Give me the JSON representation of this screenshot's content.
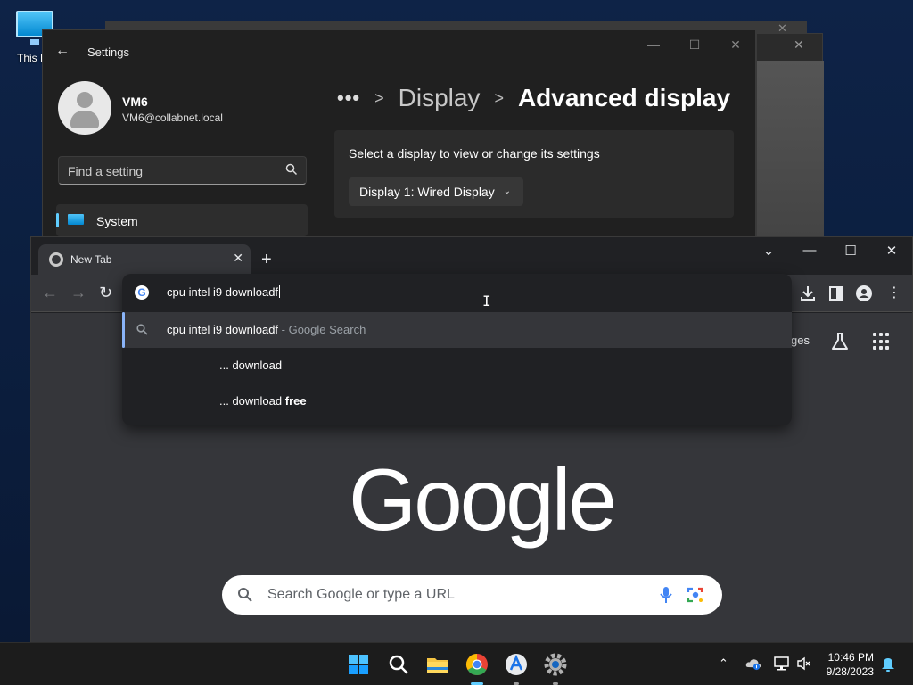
{
  "desktop": {
    "icon_label": "This P"
  },
  "settings": {
    "title": "Settings",
    "user_name": "VM6",
    "user_email": "VM6@collabnet.local",
    "search_placeholder": "Find a setting",
    "nav_item": "System",
    "breadcrumb": {
      "more": "•••",
      "parent": "Display",
      "current": "Advanced display"
    },
    "card_prompt": "Select a display to view or change its settings",
    "display_select": "Display 1: Wired Display"
  },
  "chrome": {
    "tab_title": "New Tab",
    "omnibox_text": "cpu intel i9 downloadf",
    "suggestions": [
      {
        "text": "cpu intel i9 downloadf",
        "suffix": " - Google Search"
      },
      {
        "prefix": "... ",
        "text": "download",
        "bold": ""
      },
      {
        "prefix": "... ",
        "text": "download ",
        "bold": "free"
      }
    ],
    "shortcut_images": "ges",
    "logo": "Google",
    "search_placeholder": "Search Google or type a URL"
  },
  "taskbar": {
    "time": "10:46 PM",
    "date": "9/28/2023"
  },
  "colors": {
    "accent": "#60cdff",
    "chrome_bg": "#35363a",
    "settings_bg": "#202020"
  }
}
